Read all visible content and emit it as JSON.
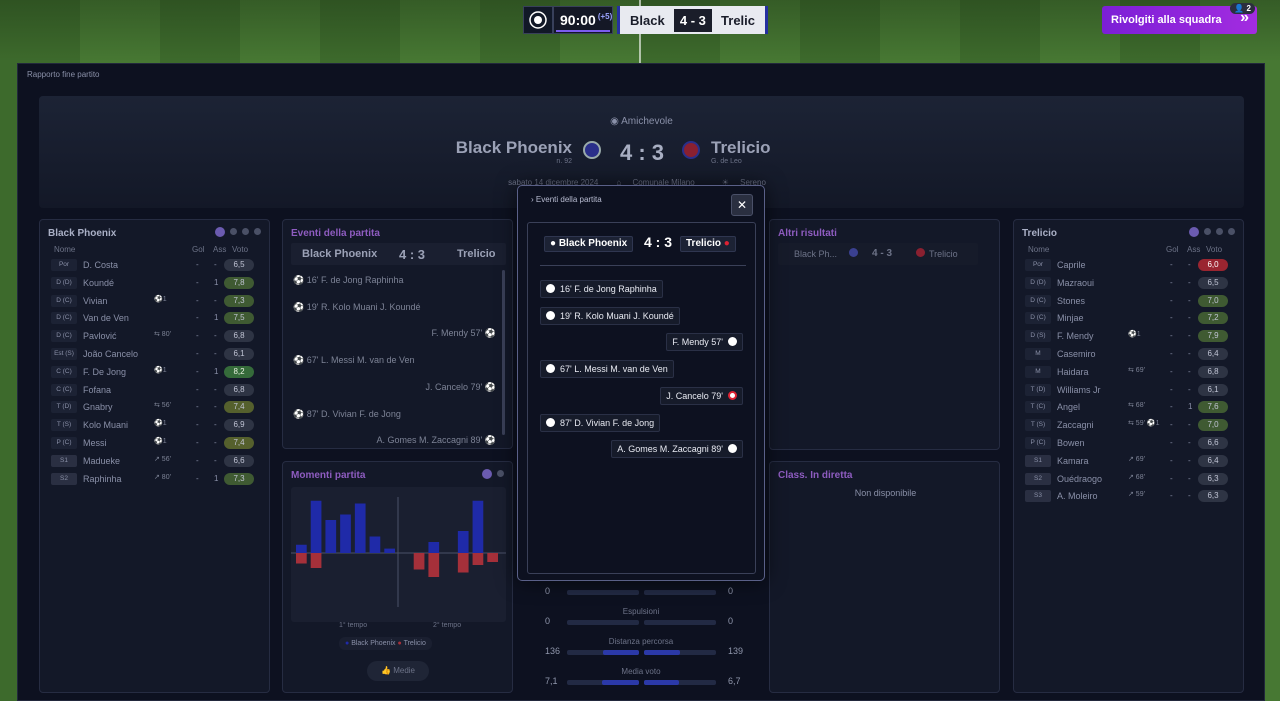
{
  "header": {
    "clock": "90:00",
    "added": "(+5)",
    "home_short": "Black",
    "away_short": "Trelic",
    "score": "4 - 3",
    "address_button": "Rivolgiti alla squadra",
    "badge_count": "2"
  },
  "report": {
    "breadcrumb": "Rapporto fine partito",
    "competition": "Amichevole",
    "home_team": "Black Phoenix",
    "home_sub": "n. 92",
    "away_team": "Trelicio",
    "away_sub": "G. de Leo",
    "score": "4 : 3",
    "date": "sabato 14 dicembre 2024",
    "venue": "Comunale Milano",
    "weather": "Sereno"
  },
  "home_panel": {
    "title": "Black Phoenix",
    "col_name": "Nome",
    "col_goals": "Gol",
    "col_assists": "Ass",
    "col_rating": "Voto",
    "players": [
      {
        "pos": "Por",
        "name": "D. Costa",
        "icon": "",
        "goals": "-",
        "assists": "-",
        "rating": "6,5",
        "tone": "n"
      },
      {
        "pos": "D (D)",
        "name": "Koundé",
        "icon": "",
        "goals": "-",
        "assists": "1",
        "rating": "7,8",
        "tone": "g"
      },
      {
        "pos": "D (C)",
        "name": "Vivian",
        "icon": "⚽1",
        "goals": "-",
        "assists": "-",
        "rating": "7,3",
        "tone": "g"
      },
      {
        "pos": "D (C)",
        "name": "Van de Ven",
        "icon": "",
        "goals": "-",
        "assists": "1",
        "rating": "7,5",
        "tone": "g"
      },
      {
        "pos": "D (C)",
        "name": "Pavlović",
        "icon": "⇆ 80'",
        "goals": "-",
        "assists": "-",
        "rating": "6,8",
        "tone": "n"
      },
      {
        "pos": "Est (S)",
        "name": "João Cancelo",
        "icon": "",
        "goals": "-",
        "assists": "-",
        "rating": "6,1",
        "tone": "n"
      },
      {
        "pos": "C (C)",
        "name": "F. De Jong",
        "icon": "⚽1",
        "goals": "-",
        "assists": "1",
        "rating": "8,2",
        "tone": "gg"
      },
      {
        "pos": "C (C)",
        "name": "Fofana",
        "icon": "",
        "goals": "-",
        "assists": "-",
        "rating": "6,8",
        "tone": "n"
      },
      {
        "pos": "T (D)",
        "name": "Gnabry",
        "icon": "⇆ 56'",
        "goals": "-",
        "assists": "-",
        "rating": "7,4",
        "tone": "y"
      },
      {
        "pos": "T (S)",
        "name": "Kolo Muani",
        "icon": "⚽1",
        "goals": "-",
        "assists": "-",
        "rating": "6,9",
        "tone": "n"
      },
      {
        "pos": "P (C)",
        "name": "Messi",
        "icon": "⚽1",
        "goals": "-",
        "assists": "-",
        "rating": "7,4",
        "tone": "y"
      },
      {
        "pos": "S1",
        "name": "Madueke",
        "icon": "↗ 56'",
        "goals": "-",
        "assists": "-",
        "rating": "6,6",
        "tone": "n"
      },
      {
        "pos": "S2",
        "name": "Raphinha",
        "icon": "↗ 80'",
        "goals": "-",
        "assists": "1",
        "rating": "7,3",
        "tone": "g"
      }
    ]
  },
  "away_panel": {
    "title": "Trelicio",
    "col_name": "Nome",
    "col_goals": "Gol",
    "col_assists": "Ass",
    "col_rating": "Voto",
    "players": [
      {
        "pos": "Por",
        "name": "Caprile",
        "icon": "",
        "goals": "-",
        "assists": "-",
        "rating": "6,0",
        "tone": "r"
      },
      {
        "pos": "D (D)",
        "name": "Mazraoui",
        "icon": "",
        "goals": "-",
        "assists": "-",
        "rating": "6,5",
        "tone": "n"
      },
      {
        "pos": "D (C)",
        "name": "Stones",
        "icon": "",
        "goals": "-",
        "assists": "-",
        "rating": "7,0",
        "tone": "g"
      },
      {
        "pos": "D (C)",
        "name": "Minjae",
        "icon": "",
        "goals": "-",
        "assists": "-",
        "rating": "7,2",
        "tone": "g"
      },
      {
        "pos": "D (S)",
        "name": "F. Mendy",
        "icon": "⚽1",
        "goals": "-",
        "assists": "-",
        "rating": "7,9",
        "tone": "g"
      },
      {
        "pos": "M",
        "name": "Casemiro",
        "icon": "",
        "goals": "-",
        "assists": "-",
        "rating": "6,4",
        "tone": "n"
      },
      {
        "pos": "M",
        "name": "Haidara",
        "icon": "⇆ 69'",
        "goals": "-",
        "assists": "-",
        "rating": "6,8",
        "tone": "n"
      },
      {
        "pos": "T (D)",
        "name": "Williams Jr",
        "icon": "",
        "goals": "-",
        "assists": "-",
        "rating": "6,1",
        "tone": "n"
      },
      {
        "pos": "T (C)",
        "name": "Angel",
        "icon": "⇆ 68'",
        "goals": "-",
        "assists": "1",
        "rating": "7,6",
        "tone": "g"
      },
      {
        "pos": "T (S)",
        "name": "Zaccagni",
        "icon": "⇆ 59' ⚽1",
        "goals": "-",
        "assists": "-",
        "rating": "7,0",
        "tone": "g"
      },
      {
        "pos": "P (C)",
        "name": "Bowen",
        "icon": "",
        "goals": "-",
        "assists": "-",
        "rating": "6,6",
        "tone": "n"
      },
      {
        "pos": "S1",
        "name": "Kamara",
        "icon": "↗ 69'",
        "goals": "-",
        "assists": "-",
        "rating": "6,4",
        "tone": "n"
      },
      {
        "pos": "S2",
        "name": "Ouédraogo",
        "icon": "↗ 68'",
        "goals": "-",
        "assists": "-",
        "rating": "6,3",
        "tone": "n"
      },
      {
        "pos": "S3",
        "name": "A. Moleiro",
        "icon": "↗ 59'",
        "goals": "-",
        "assists": "-",
        "rating": "6,3",
        "tone": "n"
      }
    ]
  },
  "events_panel": {
    "title": "Eventi della partita",
    "home": "Black Phoenix",
    "score": "4 : 3",
    "away": "Trelicio",
    "events": [
      {
        "side": "home",
        "text": "16' F. de Jong Raphinha"
      },
      {
        "side": "home",
        "text": "19' R. Kolo Muani J. Koundé"
      },
      {
        "side": "away",
        "text": "F. Mendy 57'"
      },
      {
        "side": "home",
        "text": "67' L. Messi M. van de Ven"
      },
      {
        "side": "away",
        "text": "J. Cancelo 79'"
      },
      {
        "side": "home",
        "text": "87' D. Vivian F. de Jong"
      },
      {
        "side": "away",
        "text": "A. Gomes M. Zaccagni 89'"
      }
    ]
  },
  "moments_panel": {
    "title": "Momenti partita",
    "first_half": "1° tempo",
    "second_half": "2° tempo",
    "legend_home": "Black Phoenix",
    "legend_away": "Trelicio",
    "button": "Medie"
  },
  "other_results": {
    "title": "Altri risultati",
    "home": "Black Ph...",
    "score": "4 - 3",
    "away": "Trelicio"
  },
  "live_table": {
    "title": "Class. In diretta",
    "empty": "Non disponibile"
  },
  "stats": [
    {
      "label": "",
      "home": "0",
      "away": "0",
      "home_frac": 0.0,
      "away_frac": 0.0
    },
    {
      "label": "Espulsioni",
      "home": "0",
      "away": "0",
      "home_frac": 0.0,
      "away_frac": 0.0
    },
    {
      "label": "Distanza percorsa",
      "home": "136",
      "away": "139",
      "home_frac": 0.5,
      "away_frac": 0.5
    },
    {
      "label": "Media voto",
      "home": "7,1",
      "away": "6,7",
      "home_frac": 0.52,
      "away_frac": 0.48
    }
  ],
  "modal": {
    "title": "Eventi della partita",
    "close": "✕",
    "home": "Black Phoenix",
    "score": "4 : 3",
    "away": "Trelicio",
    "events": [
      {
        "side": "home",
        "text": "16' F. de Jong Raphinha",
        "card": false
      },
      {
        "side": "home",
        "text": "19' R. Kolo Muani J. Koundé",
        "card": false
      },
      {
        "side": "away",
        "text": "F. Mendy 57'",
        "card": false
      },
      {
        "side": "home",
        "text": "67' L. Messi M. van de Ven",
        "card": false
      },
      {
        "side": "away",
        "text": "J. Cancelo 79'",
        "card": true
      },
      {
        "side": "home",
        "text": "87' D. Vivian F. de Jong",
        "card": false
      },
      {
        "side": "away",
        "text": "A. Gomes M. Zaccagni 89'",
        "card": false
      }
    ]
  },
  "chart_data": {
    "type": "bar",
    "title": "Momenti partita",
    "series": [
      {
        "name": "Black Phoenix",
        "values": [
          0.15,
          0.95,
          0.6,
          0.7,
          0.9,
          0.3,
          0.08,
          0,
          0,
          0.2,
          0,
          0.4,
          0.95,
          0
        ]
      },
      {
        "name": "Trelicio",
        "values": [
          0.35,
          0.5,
          0,
          0,
          0,
          0,
          0,
          0,
          0.55,
          0.8,
          0,
          0.65,
          0.4,
          0.3
        ]
      }
    ],
    "colors": {
      "home": "#1f2aa8",
      "away": "#a5303a"
    }
  }
}
